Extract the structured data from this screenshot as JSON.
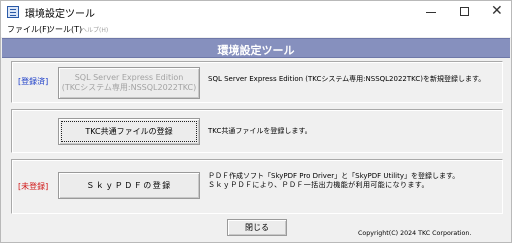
{
  "window": {
    "title": "環境設定ツール",
    "controls": {
      "minimize": "minimize",
      "maximize": "maximize",
      "close": "✕"
    }
  },
  "menu": {
    "items": [
      {
        "label": "ファイル(F)",
        "enabled": true
      },
      {
        "label": "ツール(T)",
        "enabled": true
      },
      {
        "label": "ヘルプ(H)",
        "enabled": false
      }
    ]
  },
  "header": {
    "title": "環境設定ツール"
  },
  "sections": [
    {
      "status": "[登録済]",
      "button_line1": "SQL Server Express Edition",
      "button_line2": "(TKCシステム専用:NSSQL2022TKC)",
      "button_enabled": false,
      "description": "SQL Server Express Edition (TKCシステム専用:NSSQL2022TKC)を新規登録します。"
    },
    {
      "status": "",
      "button_label": "TKC共通ファイルの登録",
      "button_enabled": true,
      "description": "TKC共通ファイルを登録します。"
    },
    {
      "status": "[未登録]",
      "button_label": "ＳｋｙＰＤＦの登録",
      "button_enabled": true,
      "description_line1": "ＰＤＦ作成ソフト「SkyPDF Pro Driver」と「SkyPDF Utility」を登録します。",
      "description_line2": "ＳｋｙＰＤＦにより、ＰＤＦ一括出力機能が利用可能になります。"
    }
  ],
  "footer": {
    "close_label": "閉じる",
    "copyright": "Copyright(C) 2024 TKC Corporation."
  },
  "colors": {
    "header_bg": "#8690be",
    "status_done": "#1a3cc8",
    "status_todo": "#d01515"
  }
}
